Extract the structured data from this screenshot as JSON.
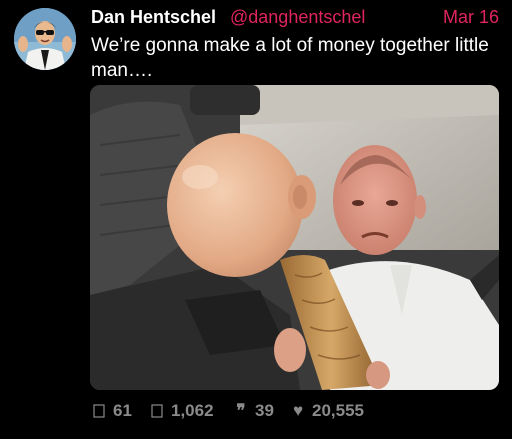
{
  "tweet": {
    "display_name": "Dan Hentschel",
    "handle": "@danghentschel",
    "date": "Mar 16",
    "text": "We’re gonna make a lot of money together little man….",
    "avatar_icon": "profile-avatar",
    "media_description_icon": "photo"
  },
  "actions": {
    "reply": {
      "icon": "reply-icon",
      "count": "61"
    },
    "retweet": {
      "icon": "retweet-icon",
      "count": "1,062"
    },
    "quote": {
      "icon": "quote-icon",
      "glyph": "❞",
      "count": "39"
    },
    "like": {
      "icon": "heart-icon",
      "glyph": "♥",
      "count": "20,555"
    }
  },
  "colors": {
    "background": "#000000",
    "text": "#ffffff",
    "accent": "#e0245e",
    "muted": "#8a8a8a"
  }
}
